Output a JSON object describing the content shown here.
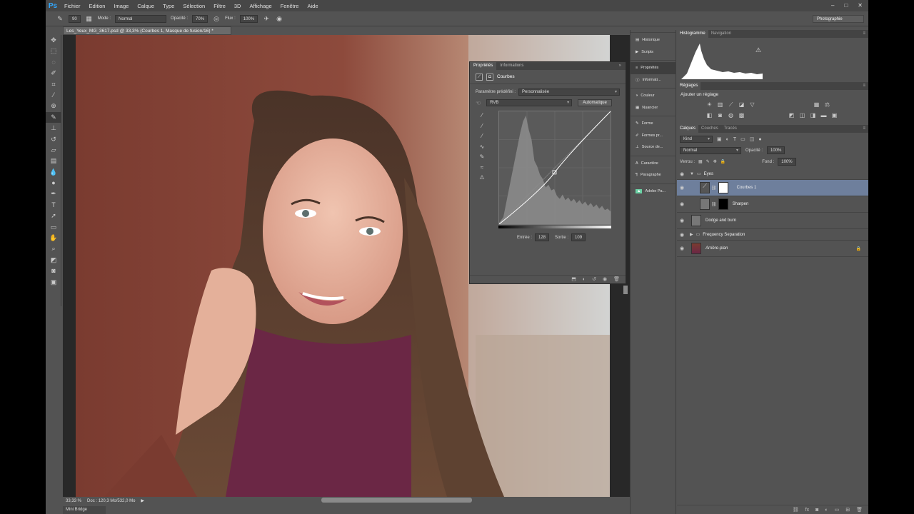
{
  "menubar": {
    "logo": "Ps",
    "items": [
      "Fichier",
      "Edition",
      "Image",
      "Calque",
      "Type",
      "Sélection",
      "Filtre",
      "3D",
      "Affichage",
      "Fenêtre",
      "Aide"
    ],
    "win_min": "–",
    "win_max": "□",
    "win_close": "✕"
  },
  "options": {
    "brush_size": "90",
    "mode_label": "Mode :",
    "mode_value": "Normal",
    "opacity_label": "Opacité :",
    "opacity_value": "70%",
    "flow_label": "Flux :",
    "flow_value": "100%",
    "workspace": "Photographie"
  },
  "document": {
    "tab_title": "Les_Yeux_MG_3617.psd @ 33,3% (Courbes 1, Masque de fusion/16) *",
    "zoom": "33,33 %",
    "doc_info": "Doc : 120,3 Mo/532,0 Mo"
  },
  "mini_bridge": "Mini Bridge",
  "properties": {
    "tabs": [
      "Propriétés",
      "Informations"
    ],
    "title": "Courbes",
    "preset_label": "Paramètre prédéfini :",
    "preset_value": "Personnalisée",
    "channel_value": "RVB",
    "auto_button": "Automatique",
    "input_label": "Entrée :",
    "input_value": "128",
    "output_label": "Sortie :",
    "output_value": "109"
  },
  "iconstrip": {
    "items": [
      "Historique",
      "Scripts",
      "Propriétés",
      "Informati...",
      "Couleur",
      "Nuancier",
      "Forme",
      "Formes pr...",
      "Source de...",
      "Caractère",
      "Paragraphe",
      "Adobe Pa..."
    ]
  },
  "right": {
    "histo_tabs": [
      "Histogramme",
      "Navigation"
    ],
    "adj_tab": "Réglages",
    "adj_title": "Ajouter un réglage",
    "layer_tabs": [
      "Calques",
      "Couches",
      "Tracés"
    ],
    "kind_value": "Kind",
    "blend_value": "Normal",
    "opacity_label": "Opacité :",
    "opacity_value": "100%",
    "lock_label": "Verrou :",
    "fill_label": "Fond :",
    "fill_value": "100%",
    "layers": [
      {
        "name": "Eyes"
      },
      {
        "name": "Courbes 1"
      },
      {
        "name": "Sharpen"
      },
      {
        "name": "Dodge and burn"
      },
      {
        "name": "Frequency Separation"
      },
      {
        "name": "Arrière-plan"
      }
    ]
  }
}
